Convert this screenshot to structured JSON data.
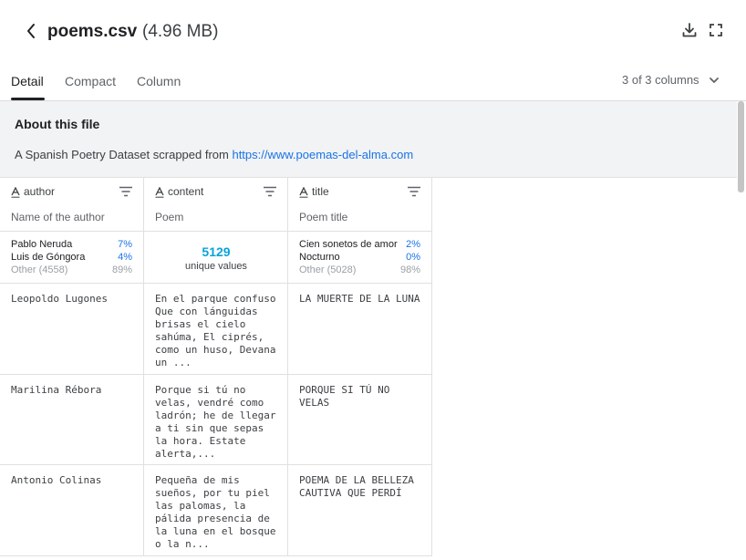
{
  "header": {
    "file_name": "poems.csv",
    "file_size": "(4.96 MB)"
  },
  "tabs": [
    {
      "label": "Detail",
      "active": true
    },
    {
      "label": "Compact",
      "active": false
    },
    {
      "label": "Column",
      "active": false
    }
  ],
  "column_selector": "3 of 3 columns",
  "about": {
    "title": "About this file",
    "description": "A Spanish Poetry Dataset scrapped from ",
    "link": "https://www.poemas-del-alma.com"
  },
  "columns": [
    {
      "name": "author",
      "description": "Name of the author",
      "stats": [
        {
          "label": "Pablo Neruda",
          "pct": "7%"
        },
        {
          "label": "Luis de Góngora",
          "pct": "4%"
        },
        {
          "label": "Other (4558)",
          "pct": "89%"
        }
      ]
    },
    {
      "name": "content",
      "description": "Poem",
      "unique_count": "5129",
      "unique_label": "unique values"
    },
    {
      "name": "title",
      "description": "Poem title",
      "stats": [
        {
          "label": "Cien sonetos de amor",
          "pct": "2%"
        },
        {
          "label": "Nocturno",
          "pct": "0%"
        },
        {
          "label": "Other (5028)",
          "pct": "98%"
        }
      ]
    }
  ],
  "rows": [
    {
      "author": "Leopoldo Lugones",
      "content": "En el parque confuso\nQue con lánguidas\nbrisas el cielo\nsahúma, El ciprés,\ncomo un huso, Devana\nun ...",
      "title": "LA MUERTE DE LA LUNA"
    },
    {
      "author": "Marilina Rébora",
      "content": "Porque si tú no\nvelas, vendré como\nladrón; he de llegar\na ti sin que sepas\nla hora. Estate\nalerta,...",
      "title": "PORQUE SI TÚ NO\nVELAS"
    },
    {
      "author": "Antonio Colinas",
      "content": "Pequeña de mis\nsueños, por tu piel\nlas palomas, la\npálida presencia de\nla luna en el bosque\no la n...",
      "title": "POEMA DE LA BELLEZA\nCAUTIVA QUE PERDÍ"
    }
  ],
  "icons": {
    "back": "chevron-left-icon",
    "download": "download-icon",
    "fullscreen": "fullscreen-icon",
    "dropdown": "chevron-down-icon",
    "column_type": "string-type-icon",
    "sort": "sort-icon"
  },
  "colors": {
    "link": "#1a73e8",
    "unique_count": "#0aa3d9",
    "about_bg": "#f1f3f4"
  }
}
